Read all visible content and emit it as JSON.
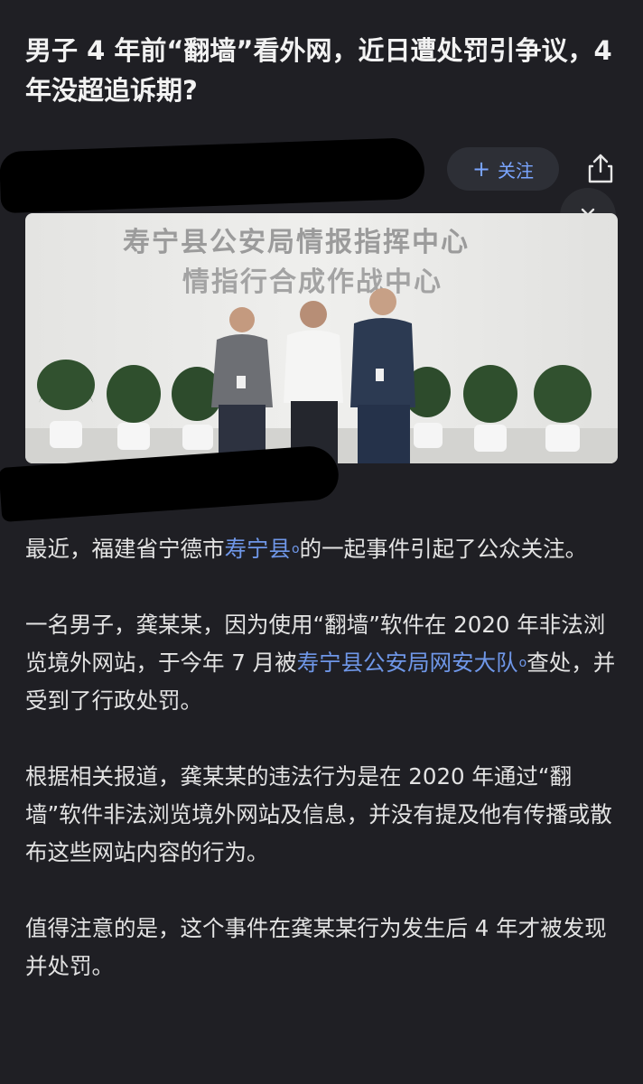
{
  "article": {
    "title": "男子 4 年前“翻墙”看外网，近日遭处罚引争议，4 年没超追诉期?",
    "follow_label": "关注",
    "image": {
      "sign_line1": "寿宁县公安局情报指挥中心",
      "sign_line2": "情指行合成作战中心"
    },
    "paragraphs": [
      {
        "pre": "最近，福建省宁德市",
        "link": "寿宁县",
        "post": "的一起事件引起了公众关注。"
      },
      {
        "pre": "一名男子，龚某某，因为使用“翻墙”软件在 2020 年非法浏览境外网站，于今年 7 月被",
        "link": "寿宁县公安局网安大队",
        "post": "查处，并受到了行政处罚。"
      },
      {
        "text": "根据相关报道，龚某某的违法行为是在 2020 年通过“翻墙”软件非法浏览境外网站及信息，并没有提及他有传播或散布这些网站内容的行为。"
      },
      {
        "text": "值得注意的是，这个事件在龚某某行为发生后 4 年才被发现并处罚。"
      }
    ]
  },
  "icons": {
    "follow": "plus-icon",
    "share": "share-icon",
    "collapse": "double-chevron-down-icon",
    "search_hint": "search-hint-icon"
  },
  "colors": {
    "background": "#1f1f24",
    "link": "#6f97e8",
    "follow_text": "#7aa5ff",
    "follow_bg": "#2d2f36"
  }
}
